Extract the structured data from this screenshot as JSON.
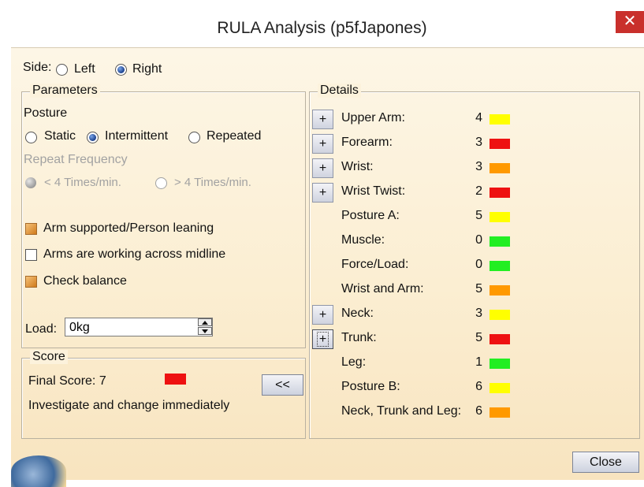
{
  "window": {
    "title": "RULA Analysis (p5fJapones)",
    "close_glyph": "✕"
  },
  "side": {
    "label": "Side:",
    "options": [
      "Left",
      "Right"
    ],
    "selected": "Right"
  },
  "parameters": {
    "legend": "Parameters",
    "posture_label": "Posture",
    "posture_options": [
      "Static",
      "Intermittent",
      "Repeated"
    ],
    "posture_selected": "Intermittent",
    "repeat_frequency_label": "Repeat Frequency",
    "repeat_options": [
      "< 4 Times/min.",
      "> 4 Times/min."
    ],
    "repeat_selected": "< 4 Times/min.",
    "checkboxes": [
      {
        "label": "Arm supported/Person leaning",
        "checked": true
      },
      {
        "label": "Arms are working across midline",
        "checked": false
      },
      {
        "label": "Check balance",
        "checked": true
      }
    ],
    "load_label": "Load:",
    "load_value": "0kg"
  },
  "score": {
    "legend": "Score",
    "final_label": "Final Score: 7",
    "final_color": "#ee1111",
    "message": "Investigate and change immediately",
    "collapse_label": "<<"
  },
  "details": {
    "legend": "Details",
    "expand_label": "+",
    "items": [
      {
        "label": "Upper Arm:",
        "value": "4",
        "color": "#ffff00",
        "expandable": true
      },
      {
        "label": "Forearm:",
        "value": "3",
        "color": "#ee1111",
        "expandable": true
      },
      {
        "label": "Wrist:",
        "value": "3",
        "color": "#ff9900",
        "expandable": true
      },
      {
        "label": "Wrist Twist:",
        "value": "2",
        "color": "#ee1111",
        "expandable": true
      },
      {
        "label": "Posture A:",
        "value": "5",
        "color": "#ffff00",
        "expandable": false
      },
      {
        "label": "Muscle:",
        "value": "0",
        "color": "#22ee22",
        "expandable": false
      },
      {
        "label": "Force/Load:",
        "value": "0",
        "color": "#22ee22",
        "expandable": false
      },
      {
        "label": "Wrist and Arm:",
        "value": "5",
        "color": "#ff9900",
        "expandable": false
      },
      {
        "label": "Neck:",
        "value": "3",
        "color": "#ffff00",
        "expandable": true
      },
      {
        "label": "Trunk:",
        "value": "5",
        "color": "#ee1111",
        "expandable": true
      },
      {
        "label": "Leg:",
        "value": "1",
        "color": "#22ee22",
        "expandable": false
      },
      {
        "label": "Posture B:",
        "value": "6",
        "color": "#ffff00",
        "expandable": false
      },
      {
        "label": "Neck, Trunk and Leg:",
        "value": "6",
        "color": "#ff9900",
        "expandable": false
      }
    ]
  },
  "footer": {
    "close_label": "Close"
  }
}
